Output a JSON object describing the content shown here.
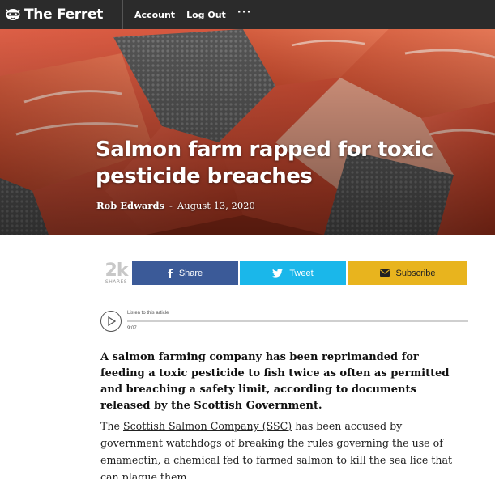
{
  "nav": {
    "brand": "The Ferret",
    "links": [
      "Account",
      "Log Out"
    ],
    "more": "···"
  },
  "hero": {
    "title": "Salmon farm rapped for toxic pesticide breaches",
    "author": "Rob Edwards",
    "separator": "-",
    "date": "August 13, 2020"
  },
  "share": {
    "count": "2k",
    "count_label": "SHARES",
    "buttons": [
      "Share",
      "Tweet",
      "Subscribe"
    ],
    "colors": {
      "facebook": "#3b5a98",
      "twitter": "#1ab7ea",
      "subscribe": "#e8b41e"
    }
  },
  "player": {
    "label": "Listen to this article",
    "time": "9:07"
  },
  "article": {
    "lede": "A salmon farming company has been reprimanded for feeding a toxic pesticide to fish twice as often as permitted and breaching a safety limit, according to documents released by the Scottish Government.",
    "para_before": "The ",
    "para_link": "Scottish Salmon Company (SSC)",
    "para_after": " has been accused by government watchdogs of breaking the rules governing the use of emamectin, a chemical fed to farmed salmon to kill the sea lice that can plague them."
  }
}
